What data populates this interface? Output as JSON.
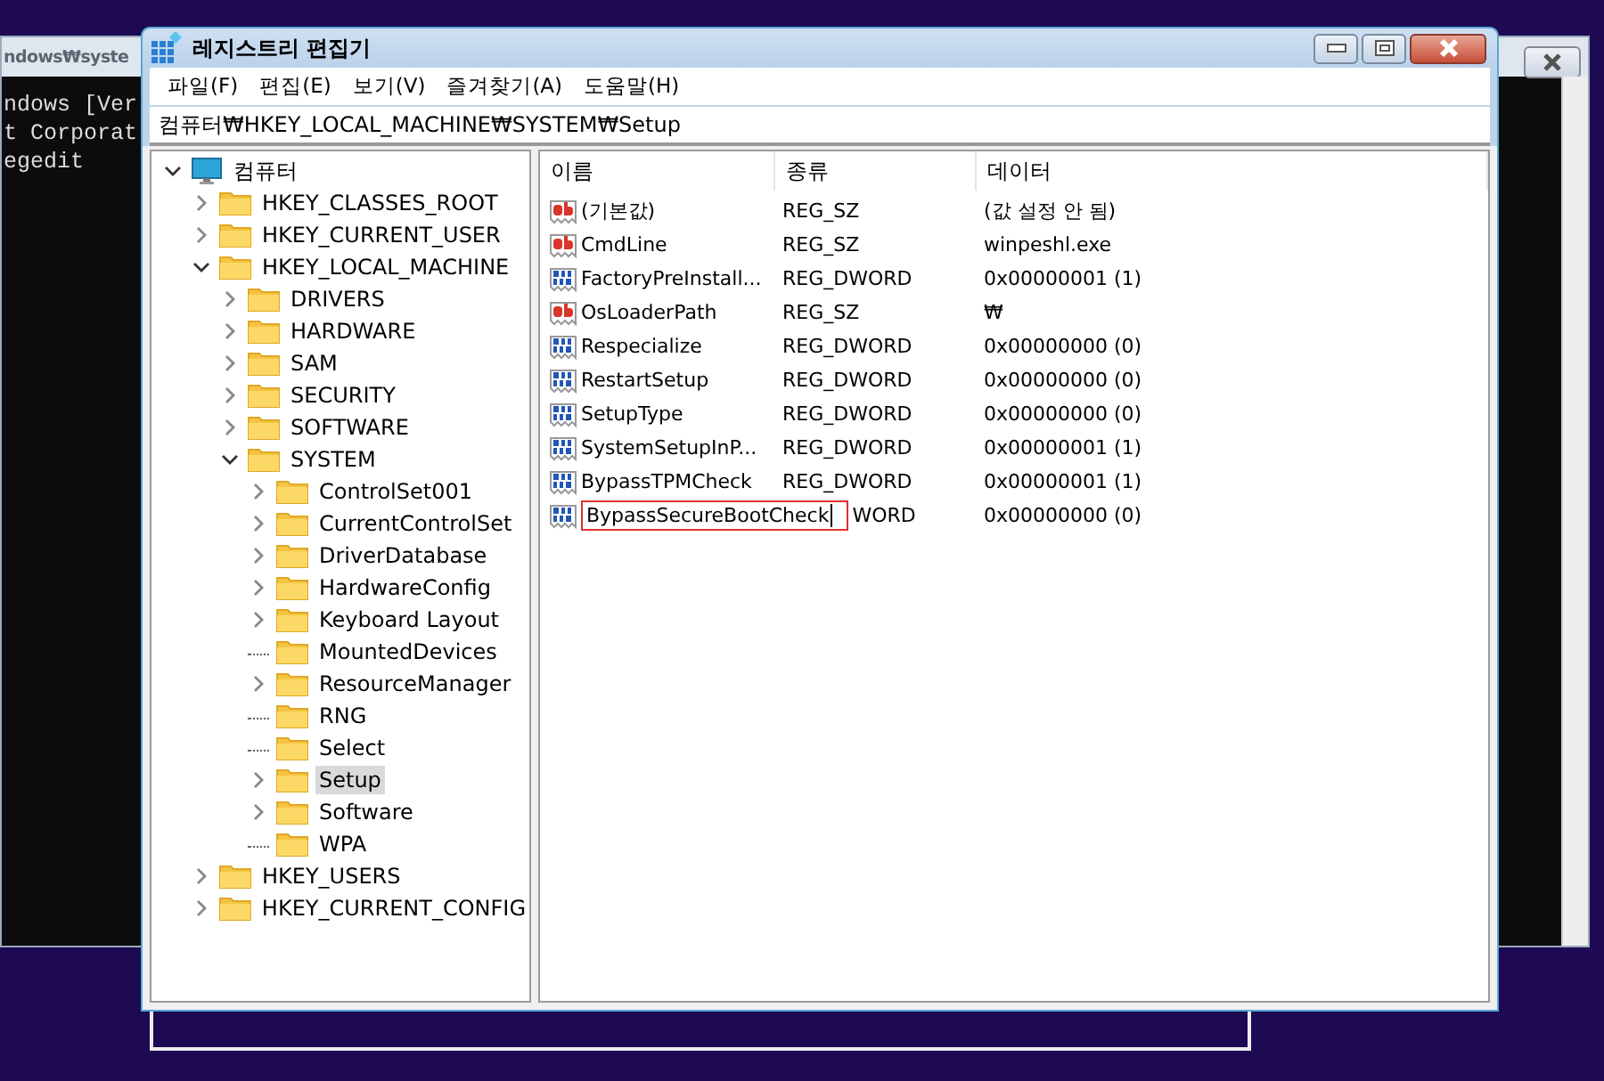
{
  "background_window": {
    "title": "ndows₩syste",
    "lines": [
      "ndows [Ver",
      "t Corporat",
      "egedit"
    ]
  },
  "window": {
    "title": "레지스트리 편집기"
  },
  "menu": [
    "파일(F)",
    "편집(E)",
    "보기(V)",
    "즐겨찾기(A)",
    "도움말(H)"
  ],
  "address": "컴퓨터₩HKEY_LOCAL_MACHINE₩SYSTEM₩Setup",
  "tree": {
    "label": "컴퓨터",
    "expanded": true,
    "selected": false,
    "children": [
      {
        "label": "HKEY_CLASSES_ROOT",
        "expandable": true,
        "expanded": false,
        "selected": false
      },
      {
        "label": "HKEY_CURRENT_USER",
        "expandable": true,
        "expanded": false,
        "selected": false
      },
      {
        "label": "HKEY_LOCAL_MACHINE",
        "expandable": true,
        "expanded": true,
        "selected": false,
        "children": [
          {
            "label": "DRIVERS",
            "expandable": true,
            "expanded": false,
            "selected": false
          },
          {
            "label": "HARDWARE",
            "expandable": true,
            "expanded": false,
            "selected": false
          },
          {
            "label": "SAM",
            "expandable": true,
            "expanded": false,
            "selected": false
          },
          {
            "label": "SECURITY",
            "expandable": true,
            "expanded": false,
            "selected": false
          },
          {
            "label": "SOFTWARE",
            "expandable": true,
            "expanded": false,
            "selected": false
          },
          {
            "label": "SYSTEM",
            "expandable": true,
            "expanded": true,
            "selected": false,
            "children": [
              {
                "label": "ControlSet001",
                "expandable": true,
                "expanded": false,
                "selected": false
              },
              {
                "label": "CurrentControlSet",
                "expandable": true,
                "expanded": false,
                "selected": false
              },
              {
                "label": "DriverDatabase",
                "expandable": true,
                "expanded": false,
                "selected": false
              },
              {
                "label": "HardwareConfig",
                "expandable": true,
                "expanded": false,
                "selected": false
              },
              {
                "label": "Keyboard Layout",
                "expandable": true,
                "expanded": false,
                "selected": false
              },
              {
                "label": "MountedDevices",
                "expandable": false,
                "selected": false
              },
              {
                "label": "ResourceManager",
                "expandable": true,
                "expanded": false,
                "selected": false
              },
              {
                "label": "RNG",
                "expandable": false,
                "selected": false
              },
              {
                "label": "Select",
                "expandable": false,
                "selected": false
              },
              {
                "label": "Setup",
                "expandable": true,
                "expanded": false,
                "selected": true
              },
              {
                "label": "Software",
                "expandable": true,
                "expanded": false,
                "selected": false
              },
              {
                "label": "WPA",
                "expandable": false,
                "selected": false
              }
            ]
          }
        ]
      },
      {
        "label": "HKEY_USERS",
        "expandable": true,
        "expanded": false,
        "selected": false
      },
      {
        "label": "HKEY_CURRENT_CONFIG",
        "expandable": true,
        "expanded": false,
        "selected": false
      }
    ]
  },
  "values": {
    "columns": [
      "이름",
      "종류",
      "데이터"
    ],
    "rows": [
      {
        "kind": "string",
        "name": "(기본값)",
        "type": "REG_SZ",
        "data": "(값 설정 안 됨)",
        "editing": false
      },
      {
        "kind": "string",
        "name": "CmdLine",
        "type": "REG_SZ",
        "data": "winpeshl.exe",
        "editing": false
      },
      {
        "kind": "dword",
        "name": "FactoryPreInstall...",
        "type": "REG_DWORD",
        "data": "0x00000001 (1)",
        "editing": false
      },
      {
        "kind": "string",
        "name": "OsLoaderPath",
        "type": "REG_SZ",
        "data": "₩",
        "editing": false
      },
      {
        "kind": "dword",
        "name": "Respecialize",
        "type": "REG_DWORD",
        "data": "0x00000000 (0)",
        "editing": false
      },
      {
        "kind": "dword",
        "name": "RestartSetup",
        "type": "REG_DWORD",
        "data": "0x00000000 (0)",
        "editing": false
      },
      {
        "kind": "dword",
        "name": "SetupType",
        "type": "REG_DWORD",
        "data": "0x00000000 (0)",
        "editing": false
      },
      {
        "kind": "dword",
        "name": "SystemSetupInP...",
        "type": "REG_DWORD",
        "data": "0x00000001 (1)",
        "editing": false
      },
      {
        "kind": "dword",
        "name": "BypassTPMCheck",
        "type": "REG_DWORD",
        "data": "0x00000001 (1)",
        "editing": false
      },
      {
        "kind": "dword",
        "name": "BypassSecureBootCheck",
        "type": "WORD",
        "data": "0x00000000 (0)",
        "editing": true
      }
    ]
  }
}
